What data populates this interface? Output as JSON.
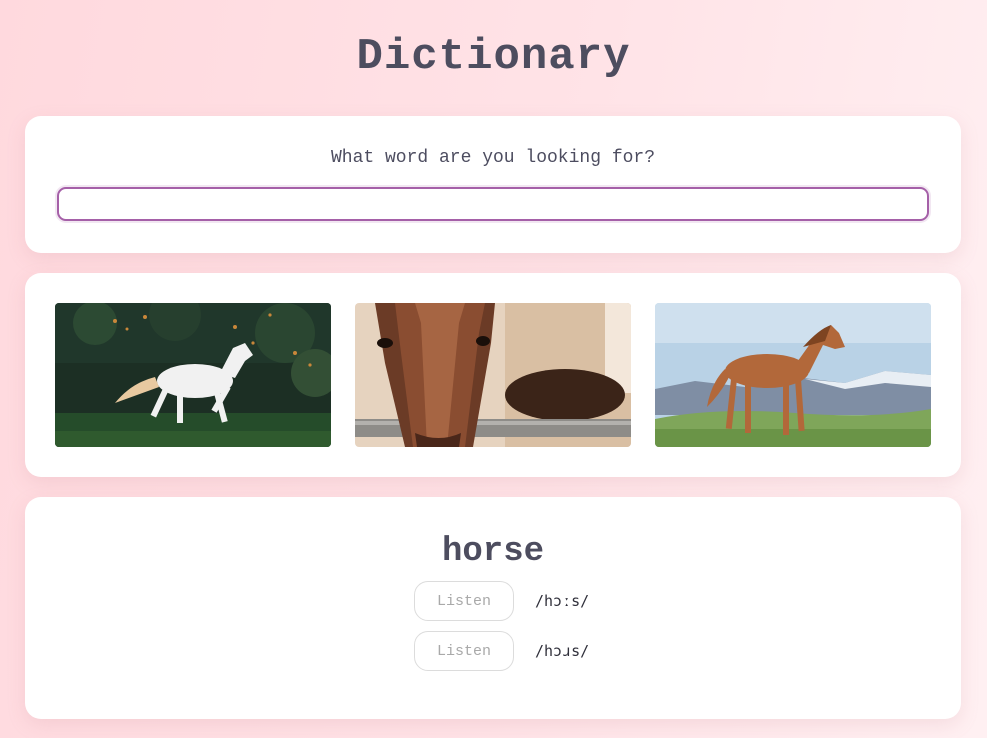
{
  "header": {
    "title": "Dictionary"
  },
  "search": {
    "prompt": "What word are you looking for?",
    "value": "",
    "placeholder": ""
  },
  "photos": [
    {
      "icon": "white-horse-photo"
    },
    {
      "icon": "horse-head-photo"
    },
    {
      "icon": "brown-horse-photo"
    }
  ],
  "entry": {
    "word": "horse",
    "phonetics": [
      {
        "listen_label": "Listen",
        "text": "/hɔːs/"
      },
      {
        "listen_label": "Listen",
        "text": "/hɔɹs/"
      }
    ]
  },
  "colors": {
    "accent": "#a560a8",
    "text": "#4d4d60",
    "background_pink": "#ffd9de"
  }
}
